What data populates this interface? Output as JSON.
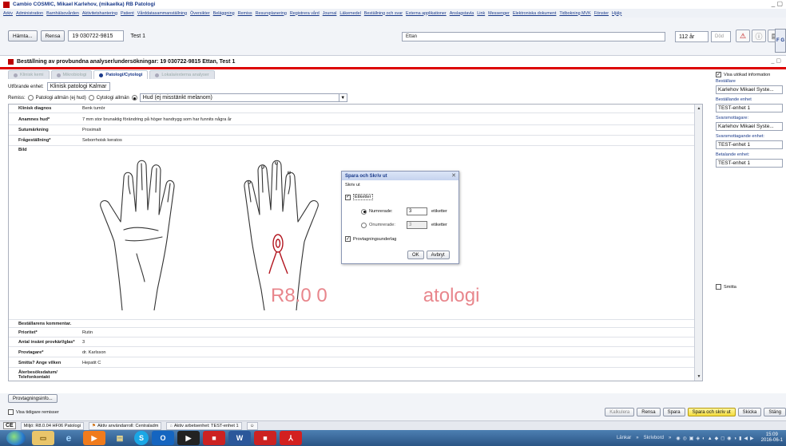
{
  "window": {
    "title": "Cambio COSMIC, Mikael Karlehov, (mikaelka) RB Patologi",
    "controls": "_ ▢"
  },
  "menu": [
    "Arkiv",
    "Administration",
    "Barnhälsovården",
    "Aktivitetshantering",
    "Patient",
    "Vårddatasammanställning",
    "Översikter",
    "Beläggning",
    "Remiss",
    "Resursplanering",
    "Registrera vård",
    "Journal",
    "Läkemedel",
    "Beställning och svar",
    "Externa applikationer",
    "Anslagstavla",
    "Link",
    "Messenger",
    "Elektroniska dokument",
    "Tidbokning MVK",
    "Fönster",
    "Hjälp"
  ],
  "patient": {
    "fetch_label": "Hämta...",
    "clear_label": "Rensa",
    "personal_id": "19 030722-9815",
    "name": "Test 1",
    "surname_field": "Ettan",
    "age": "112 år",
    "dod": "Död",
    "fg_label": "F G"
  },
  "order": {
    "title": "Beställning av provbundna analyser/undersökningar: 19 030722-9815 Ettan, Test 1",
    "controls": "_ ▢"
  },
  "tabs": [
    {
      "label": "Klinisk kemi",
      "active": false
    },
    {
      "label": "Mikrobiologi",
      "active": false
    },
    {
      "label": "Patologi/Cytologi",
      "active": true
    },
    {
      "label": "Lokala/externa analyser",
      "active": false
    }
  ],
  "lab": {
    "label": "Utförande enhet:",
    "value": "Klinisk patologi Kalmar"
  },
  "remiss": {
    "label": "Remiss:",
    "options": [
      "Patologi allmän (ej hud)",
      "Cytologi allmän",
      "Hud (ej misstänkt melanom)"
    ],
    "selected": "Hud (ej misstänkt melanom)"
  },
  "form": {
    "top_rows": [
      {
        "key": "Klinisk diagnos",
        "value": "Benk tumör"
      },
      {
        "key": "Anamnes hud*",
        "value": "7 mm stor brunaktig förändring på höger handrygg som har funnits några år"
      },
      {
        "key": "Sutumärkning",
        "value": "Proximalt"
      },
      {
        "key": "Frågeställning*",
        "value": "Seborrhoisk keratos"
      },
      {
        "key": "Bild",
        "value": ""
      }
    ],
    "bottom_rows": [
      {
        "key": "Beställarens kommentar.",
        "value": ""
      },
      {
        "key": "Prioritet*",
        "value": "Rutin"
      },
      {
        "key": "Antal insänt provkärl/glas*",
        "value": "3"
      },
      {
        "key": "Provtagare*",
        "value": "dr. Karlsson"
      },
      {
        "key": "Smitta? Ange vilken",
        "value": "Hepatit C"
      },
      {
        "key": "Återbesöksdatum/ Telefonkontakt",
        "value": ""
      }
    ]
  },
  "watermark": {
    "text1": "R8.0 0",
    "text2": "atologi"
  },
  "dialog": {
    "title": "Spara och Skriv ut",
    "section": "Skriv ut",
    "labels_option": "Etiketter",
    "numbered_label": "Numrerade:",
    "numbered_value": "3",
    "unnumbered_label": "Onumrerade:",
    "unnumbered_value": "3",
    "unit": "etiketter",
    "sampling_doc": "Provtagningsunderlag",
    "ok": "OK",
    "cancel": "Avbryt",
    "close": "✕"
  },
  "sidebar": {
    "show_info": "Visa utökad information",
    "orderer_label": "Beställare",
    "orderer": "Karlehov Mikael Syste...",
    "ordering_unit_label": "Beställande enhet",
    "ordering_unit": "TEST-enhet 1",
    "recipient_label": "Svarsmottagare:",
    "recipient": "Karlehov Mikael Syste...",
    "recipient_unit_label": "Svarsmottagande enhet:",
    "recipient_unit": "TEST-enhet 1",
    "paying_unit_label": "Betalande enhet:",
    "paying_unit": "TEST-enhet 1",
    "infection": "Smitta"
  },
  "bottom": {
    "sampling_info": "Provtagningsinfo...",
    "show_prev": "Visa tidigare remisser",
    "actions": [
      "Kalkulera",
      "Rensa",
      "Spara",
      "Spara och skriv ut",
      "Skicka",
      "Stäng"
    ]
  },
  "status": {
    "ce": "CE",
    "env": "Miljö: R8.0.04 HF06 Patologi",
    "role": "Aktiv användarroll: Centraladm",
    "unit": "Aktiv arbetsenhet: TEST-enhet 1"
  },
  "taskbar": {
    "links": "Länkar",
    "desktop": "Skrivbord",
    "time": "15:09",
    "date": "2016-06-1"
  },
  "colors": {
    "accent": "#1a3a8a",
    "brand_red": "#d00000",
    "highlight": "#f3dc3c"
  }
}
